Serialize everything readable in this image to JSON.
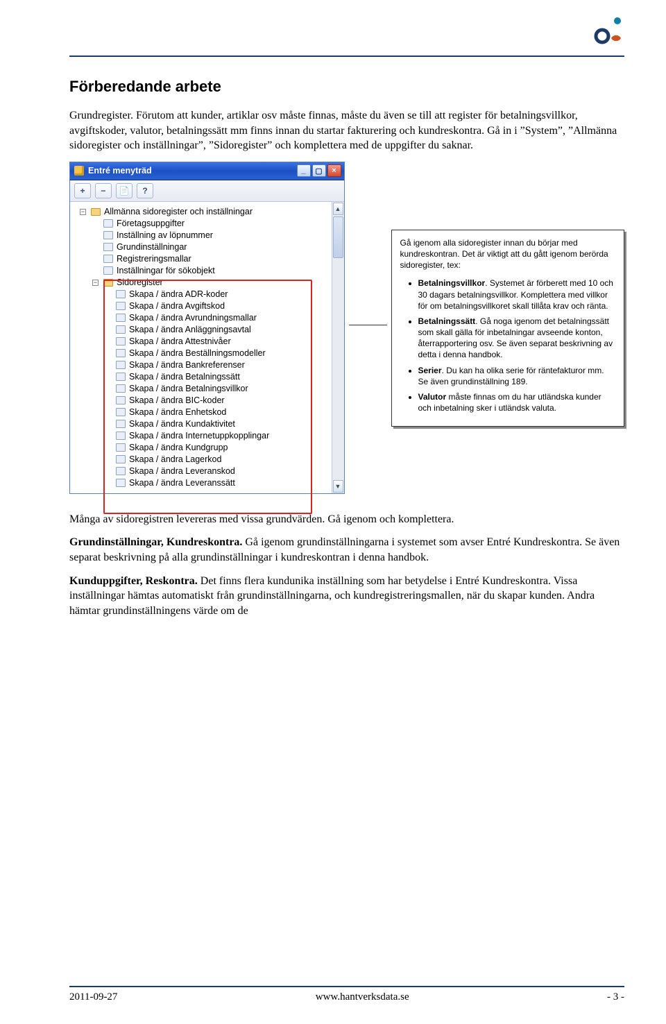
{
  "header": {
    "logo_alt": "ob logo"
  },
  "heading": "Förberedande arbete",
  "intro": "Grundregister. Förutom att kunder, artiklar osv måste finnas, måste du även se till att register för betalningsvillkor, avgiftskoder, valutor, betalningssätt mm finns innan du startar fakturering och kundreskontra. Gå in i ”System”, ”Allmänna sidoregister och inställningar”, ”Sidoregister” och komplettera med de uppgifter du saknar.",
  "window": {
    "title": "Entré menyträd",
    "toolbar": {
      "btn1": "+",
      "btn2": "−",
      "btn3": "📄",
      "btn4": "?"
    },
    "scrollbar": {
      "up": "▲",
      "down": "▼"
    },
    "tree": {
      "group1_label": "Allmänna sidoregister och inställningar",
      "group1": [
        "Företagsuppgifter",
        "Inställning av löpnummer",
        "Grundinställningar",
        "Registreringsmallar",
        "Inställningar för sökobjekt"
      ],
      "group2_label": "Sidoregister",
      "group2": [
        "Skapa / ändra ADR-koder",
        "Skapa / ändra Avgiftskod",
        "Skapa / ändra Avrundningsmallar",
        "Skapa / ändra Anläggningsavtal",
        "Skapa / ändra Attestnivåer",
        "Skapa / ändra Beställningsmodeller",
        "Skapa / ändra Bankreferenser",
        "Skapa / ändra Betalningssätt",
        "Skapa / ändra Betalningsvillkor",
        "Skapa / ändra BIC-koder",
        "Skapa / ändra Enhetskod",
        "Skapa / ändra Kundaktivitet",
        "Skapa / ändra Internetuppkopplingar",
        "Skapa / ändra Kundgrupp",
        "Skapa / ändra Lagerkod",
        "Skapa / ändra Leveranskod",
        "Skapa / ändra Leveranssätt"
      ]
    }
  },
  "callout": {
    "intro": "Gå igenom alla sidoregister innan du börjar med kundreskontran. Det är viktigt att du gått igenom berörda sidoregister, tex:",
    "items": [
      {
        "bold": "Betalningsvillkor",
        "text": ". Systemet är förberett med 10 och 30 dagars betalningsvillkor. Komplettera med villkor för om betalningsvillkoret skall tillåta krav och ränta."
      },
      {
        "bold": "Betalningssätt",
        "text": ". Gå noga igenom det betalningssätt som skall gälla för inbetalningar avseende konton, återrapportering osv. Se även separat beskrivning av detta i denna handbok."
      },
      {
        "bold": "Serier",
        "text": ". Du kan ha olika serie för räntefakturor mm. Se även grundinställning 189."
      },
      {
        "bold": "Valutor",
        "text": " måste finnas om du har utländska kunder och inbetalning sker i utländsk valuta."
      }
    ]
  },
  "body": {
    "p1": "Många av sidoregistren levereras med vissa grundvärden. Gå igenom och komplettera.",
    "p2_bold": "Grundinställningar, Kundreskontra.",
    "p2_rest": " Gå igenom grundinställningarna i systemet som avser Entré Kundreskontra. Se även separat beskrivning på alla grundinställningar i kundreskontran i denna handbok.",
    "p3_bold": "Kunduppgifter, Reskontra.",
    "p3_rest": " Det finns flera kundunika inställning som har betydelse i Entré Kundreskontra. Vissa inställningar hämtas automatiskt från grundinställningarna, och kundregistreringsmallen, när du skapar kunden. Andra hämtar grundinställningens värde om de"
  },
  "footer": {
    "left": "2011-09-27",
    "center": "www.hantverksdata.se",
    "right": "- 3 -"
  }
}
